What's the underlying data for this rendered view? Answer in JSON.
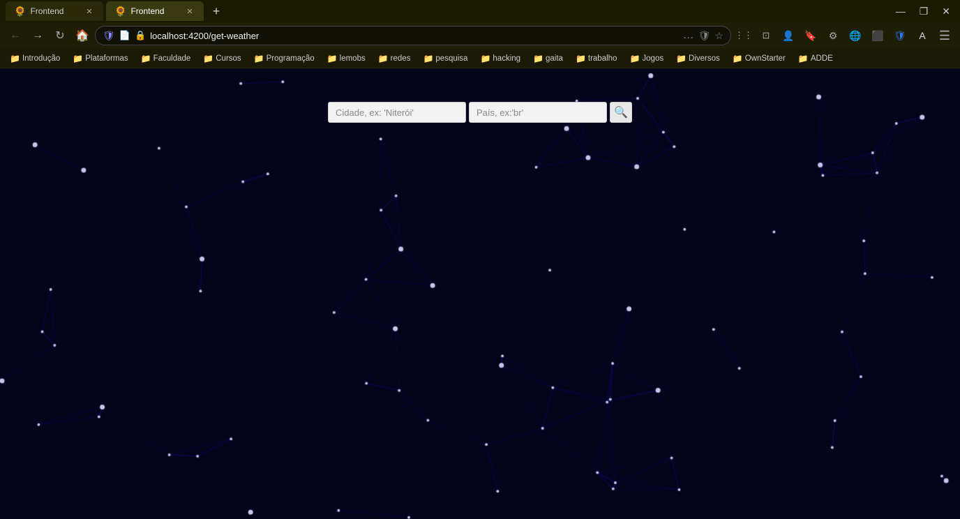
{
  "titlebar": {
    "tabs": [
      {
        "id": "tab1",
        "label": "Frontend",
        "icon": "🌻",
        "active": false
      },
      {
        "id": "tab2",
        "label": "Frontend",
        "icon": "🌻",
        "active": true
      }
    ],
    "new_tab_label": "+",
    "window_controls": [
      "—",
      "❐",
      "✕"
    ]
  },
  "navbar": {
    "back_title": "Back",
    "forward_title": "Forward",
    "refresh_title": "Refresh",
    "home_title": "Home",
    "url": "localhost:4200/get-weather",
    "shield_icon": "shield",
    "lock_icon": "lock",
    "star_icon": "⭐",
    "more_icon": "…"
  },
  "bookmarks": [
    {
      "label": "Introdução",
      "icon": "📁"
    },
    {
      "label": "Plataformas",
      "icon": "📁"
    },
    {
      "label": "Faculdade",
      "icon": "📁"
    },
    {
      "label": "Cursos",
      "icon": "📁"
    },
    {
      "label": "Programação",
      "icon": "📁"
    },
    {
      "label": "lemobs",
      "icon": "📁"
    },
    {
      "label": "redes",
      "icon": "📁"
    },
    {
      "label": "pesquisa",
      "icon": "📁"
    },
    {
      "label": "hacking",
      "icon": "📁"
    },
    {
      "label": "gaita",
      "icon": "📁"
    },
    {
      "label": "trabalho",
      "icon": "📁"
    },
    {
      "label": "Jogos",
      "icon": "📁"
    },
    {
      "label": "Diversos",
      "icon": "📁"
    },
    {
      "label": "OwnStarter",
      "icon": "📁"
    },
    {
      "label": "ADDE",
      "icon": "📁"
    }
  ],
  "search": {
    "city_placeholder": "Cidade, ex: 'Niterói'",
    "country_placeholder": "País, ex:'br'",
    "search_icon": "🔍"
  },
  "colors": {
    "bg": "#04041a",
    "node_color": "#ffffff",
    "line_color": "#2222aa",
    "dim_line_color": "#111155"
  }
}
